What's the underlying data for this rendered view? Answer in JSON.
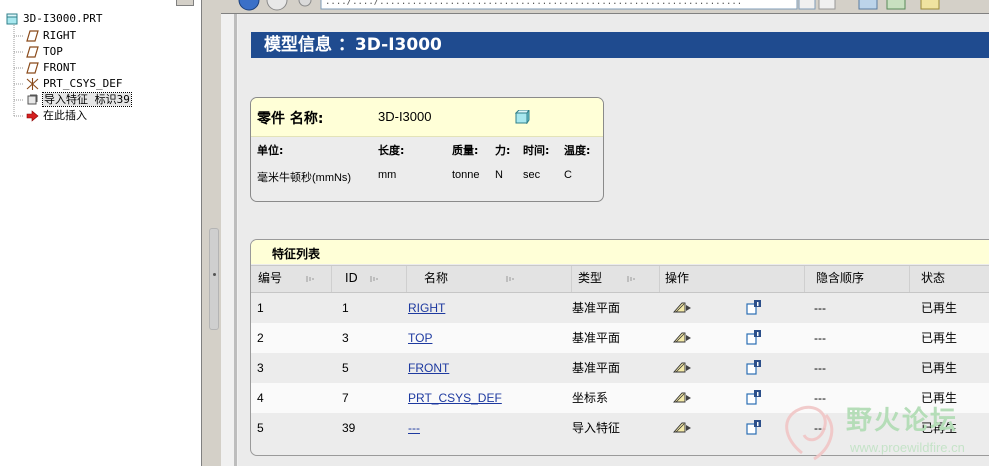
{
  "tree": {
    "root": "3D-I3000.PRT",
    "items": [
      {
        "label": "RIGHT",
        "icon": "datum-plane-icon"
      },
      {
        "label": "TOP",
        "icon": "datum-plane-icon"
      },
      {
        "label": "FRONT",
        "icon": "datum-plane-icon"
      },
      {
        "label": "PRT_CSYS_DEF",
        "icon": "csys-icon"
      },
      {
        "label": "导入特征 标识39",
        "icon": "import-feature-icon"
      },
      {
        "label": "在此插入",
        "icon": "insert-here-arrow-icon"
      }
    ]
  },
  "browser": {
    "address_fragment": "..../..../..................................................................."
  },
  "header": {
    "title": "模型信息 ：3D-I3000"
  },
  "part_info": {
    "label": "零件  名称:",
    "name": "3D-I3000",
    "unit_headers": [
      "单位:",
      "长度:",
      "质量:",
      "力:",
      "时间:",
      "温度:"
    ],
    "unit_values": [
      "毫米牛顿秒(mmNs)",
      "mm",
      "tonne",
      "N",
      "sec",
      "C"
    ]
  },
  "feature_list": {
    "caption": "特征列表",
    "columns": [
      "编号",
      "ID",
      "名称",
      "类型",
      "操作",
      "隐含顺序",
      "状态"
    ],
    "rows": [
      {
        "no": "1",
        "id": "1",
        "name": "RIGHT",
        "type": "基准平面",
        "order": "---",
        "status": "已再生"
      },
      {
        "no": "2",
        "id": "3",
        "name": "TOP",
        "type": "基准平面",
        "order": "---",
        "status": "已再生"
      },
      {
        "no": "3",
        "id": "5",
        "name": "FRONT",
        "type": "基准平面",
        "order": "---",
        "status": "已再生"
      },
      {
        "no": "4",
        "id": "7",
        "name": "PRT_CSYS_DEF",
        "type": "坐标系",
        "order": "---",
        "status": "已再生"
      },
      {
        "no": "5",
        "id": "39",
        "name": "---",
        "type": "导入特征",
        "order": "---",
        "status": "已再生"
      }
    ]
  },
  "watermark": {
    "text": "野火论坛",
    "url": "www.proewildfire.cn"
  },
  "colors": {
    "header_bg": "#1f4b8f",
    "card_head_bg": "#ffffd7",
    "link": "#1e3aa0"
  }
}
